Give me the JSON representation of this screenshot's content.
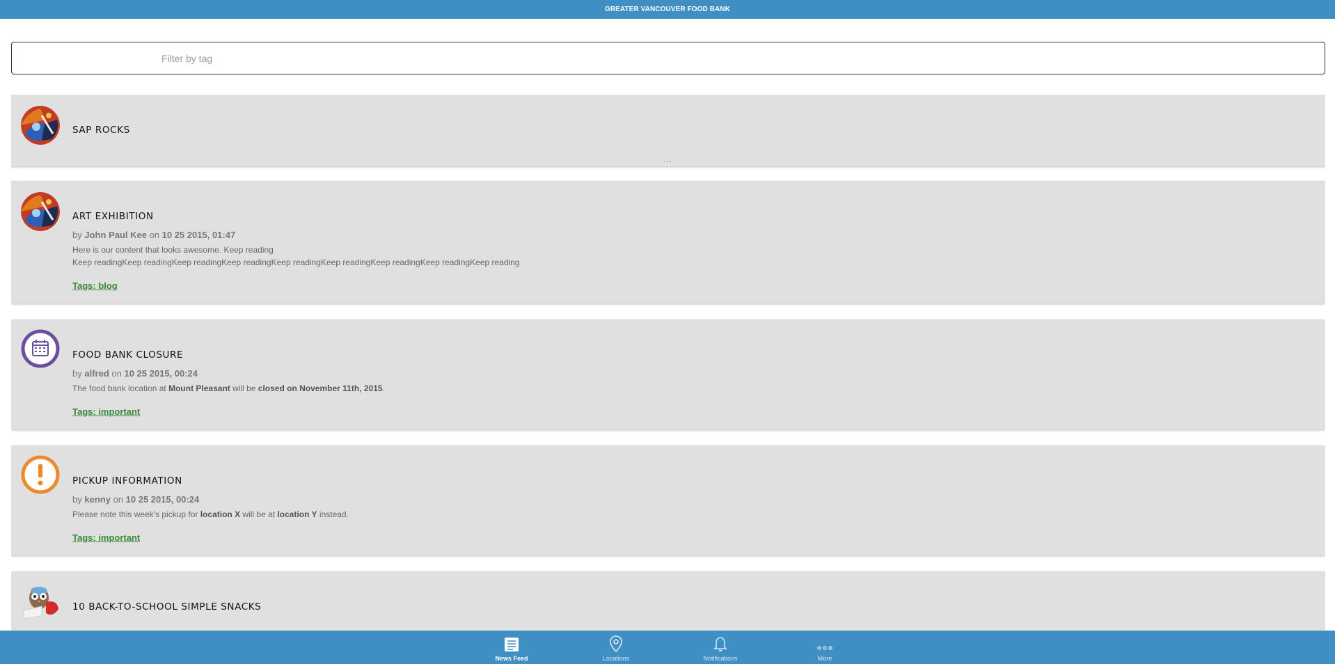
{
  "header": {
    "title": "GREATER VANCOUVER FOOD BANK"
  },
  "filter": {
    "placeholder": "Filter by tag"
  },
  "feed": {
    "items": [
      {
        "title": "SAP ROCKS",
        "more": "..."
      },
      {
        "title": "ART EXHIBITION",
        "by_prefix": "by",
        "author": "John Paul Kee",
        "on": "on",
        "date": "10 25 2015, 01:47",
        "line1": "Here is our content that looks awesome. Keep reading",
        "line2": "Keep readingKeep readingKeep readingKeep readingKeep readingKeep readingKeep readingKeep readingKeep reading",
        "tags": "Tags: blog"
      },
      {
        "title": "FOOD BANK CLOSURE",
        "by_prefix": "by",
        "author": "alfred",
        "on": "on",
        "date": "10 25 2015, 00:24",
        "text_a": "The food bank location at ",
        "bold_a": "Mount Pleasant",
        "text_b": " will be ",
        "bold_b": "closed on November 11th, 2015",
        "text_c": ".",
        "tags": "Tags: important"
      },
      {
        "title": "PICKUP INFORMATION",
        "by_prefix": "by",
        "author": "kenny",
        "on": "on",
        "date": "10 25 2015, 00:24",
        "text_a": "Please note this week's pickup for ",
        "bold_a": "location X",
        "text_b": " will be at ",
        "bold_b": "location Y",
        "text_c": " instead.",
        "tags": "Tags: important"
      },
      {
        "title": "10 BACK-TO-SCHOOL SIMPLE SNACKS"
      }
    ]
  },
  "nav": {
    "tabs": [
      {
        "label": "News Feed",
        "icon": "news-feed-icon",
        "active": true
      },
      {
        "label": "Locations",
        "icon": "location-pin-icon",
        "active": false
      },
      {
        "label": "Notifications",
        "icon": "bell-icon",
        "active": false
      },
      {
        "label": "More",
        "icon": "more-dots-icon",
        "active": false
      }
    ]
  },
  "colors": {
    "brand": "#3f8fc4",
    "card": "#e0e0e0",
    "tag": "#3a8a3a",
    "calendar_ring": "#6b4f9e",
    "alert_ring": "#ec8a2a"
  }
}
